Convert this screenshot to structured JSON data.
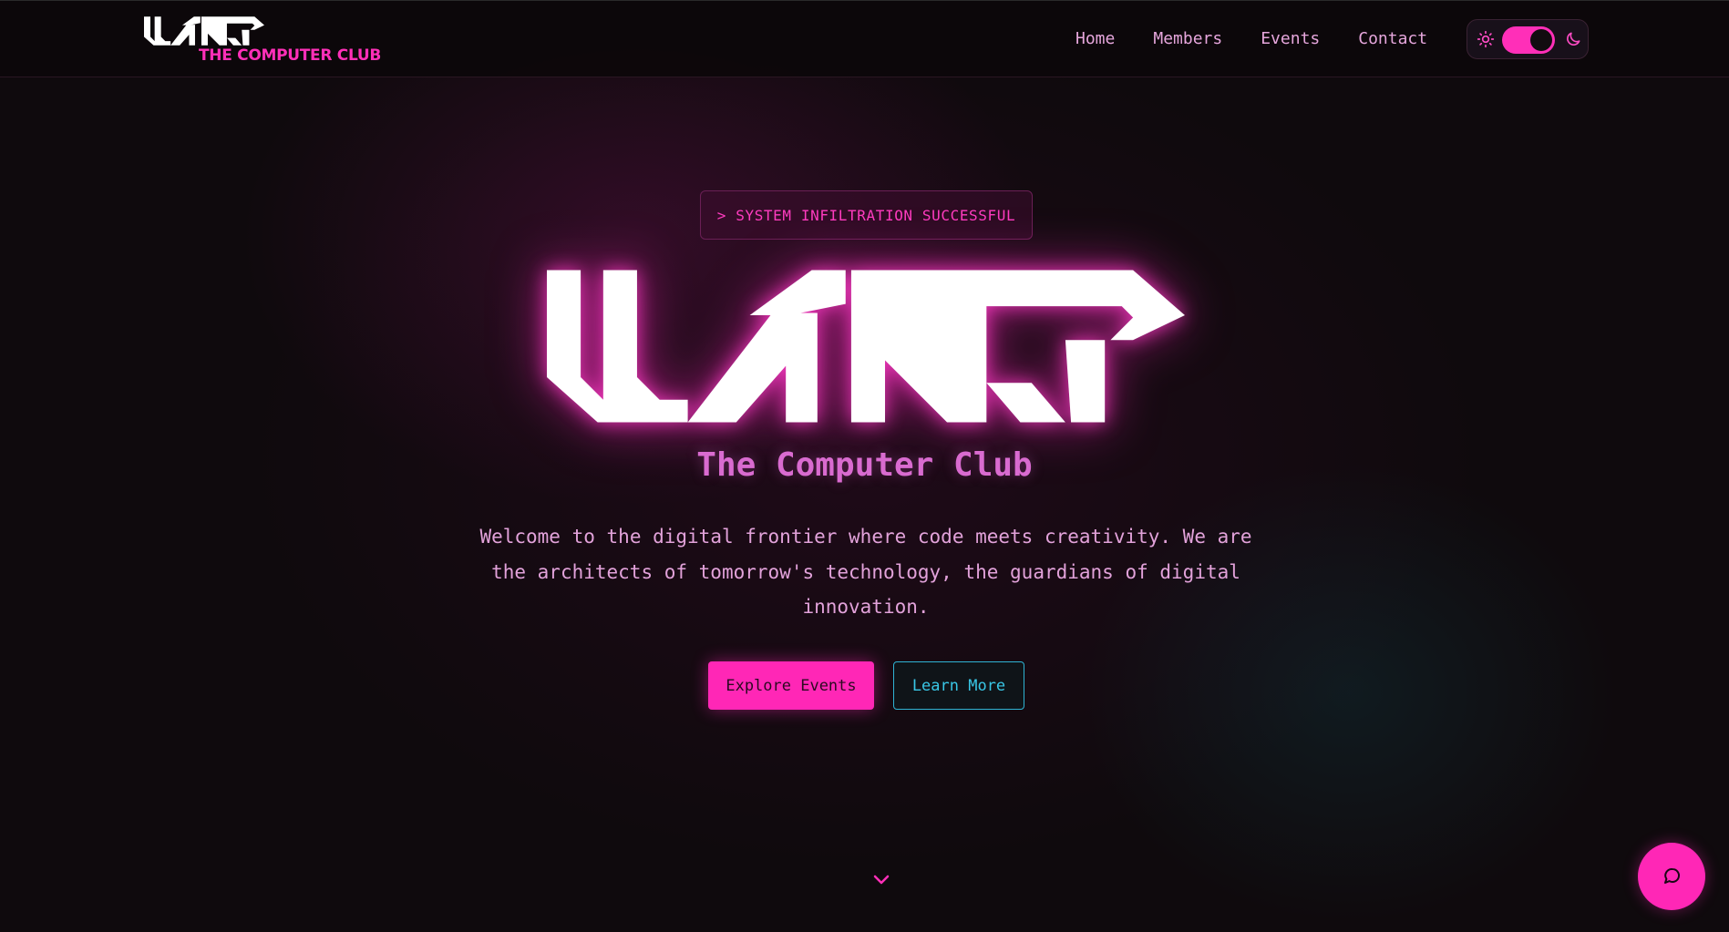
{
  "nav": {
    "logo_sub": "THE COMPUTER CLUB",
    "links": [
      "Home",
      "Members",
      "Events",
      "Contact"
    ],
    "theme_toggle": {
      "mode": "dark"
    }
  },
  "hero": {
    "badge": "> SYSTEM INFILTRATION SUCCESSFUL",
    "title": "The Computer Club",
    "description": "Welcome to the digital frontier where code meets creativity. We are the architects of tomorrow's technology, the guardians of digital innovation.",
    "primary_button": "Explore Events",
    "secondary_button": "Learn More"
  },
  "colors": {
    "accent": "#ff27b6",
    "secondary": "#2fb4d4",
    "background": "#0f0a0d"
  },
  "icons": {
    "theme_light": "sun-icon",
    "theme_dark": "moon-icon",
    "scroll": "chevron-down-icon",
    "chat": "chat-bubble-icon"
  }
}
